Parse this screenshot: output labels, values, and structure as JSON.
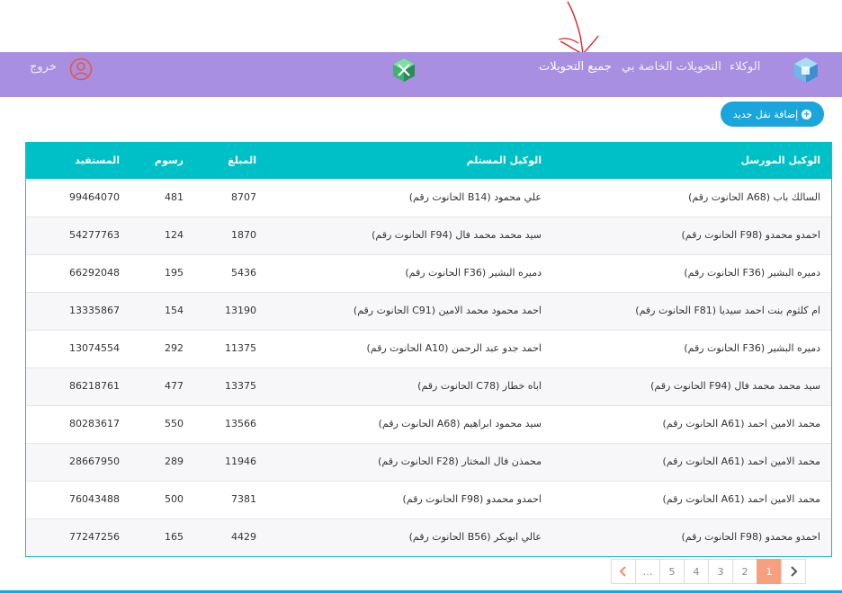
{
  "nav": {
    "agents": "الوكلاء",
    "my_transfers": "التحويلات الخاصة بي",
    "all_transfers": "جميع التحويلات",
    "logout": "خروج"
  },
  "actions": {
    "add_transfer": "إضافة نقل جديد"
  },
  "table": {
    "headers": {
      "sender": "الوكيل المورسل",
      "receiver": "الوكيل المستلم",
      "amount": "المبلغ",
      "fee": "رسوم",
      "beneficiary": "المستفيد"
    },
    "rows": [
      {
        "sender": "السالك باب (A68 الحانوت رقم)",
        "receiver": "علي محمود (B14 الحانوت رقم)",
        "amount": "8707",
        "fee": "481",
        "beneficiary": "99464070"
      },
      {
        "sender": "احمدو محمدو (F98 الحانوت رقم)",
        "receiver": "سيد محمد محمد فال (F94 الحانوت رقم)",
        "amount": "1870",
        "fee": "124",
        "beneficiary": "54277763"
      },
      {
        "sender": "دميره البشير (F36 الحانوت رقم)",
        "receiver": "دميره البشير (F36 الحانوت رقم)",
        "amount": "5436",
        "fee": "195",
        "beneficiary": "66292048"
      },
      {
        "sender": "ام كلثوم بنت احمد سيديا (F81 الحانوت رقم)",
        "receiver": "احمد محمود محمد الامين (C91 الحانوت رقم)",
        "amount": "13190",
        "fee": "154",
        "beneficiary": "13335867"
      },
      {
        "sender": "دميره البشير (F36 الحانوت رقم)",
        "receiver": "احمد جدو عبد الرحمن (A10 الحانوت رقم)",
        "amount": "11375",
        "fee": "292",
        "beneficiary": "13074554"
      },
      {
        "sender": "سيد محمد محمد فال (F94 الحانوت رقم)",
        "receiver": "اباه خطار (C78 الحانوت رقم)",
        "amount": "13375",
        "fee": "477",
        "beneficiary": "86218761"
      },
      {
        "sender": "محمد الامين احمد (A61 الحانوت رقم)",
        "receiver": "سيد محمود ابراهيم (A68 الحانوت رقم)",
        "amount": "13566",
        "fee": "550",
        "beneficiary": "80283617"
      },
      {
        "sender": "محمد الامين احمد (A61 الحانوت رقم)",
        "receiver": "محمذن فال المختار (F28 الحانوت رقم)",
        "amount": "11946",
        "fee": "289",
        "beneficiary": "28667950"
      },
      {
        "sender": "محمد الامين احمد (A61 الحانوت رقم)",
        "receiver": "احمدو محمدو (F98 الحانوت رقم)",
        "amount": "7381",
        "fee": "500",
        "beneficiary": "76043488"
      },
      {
        "sender": "احمدو محمدو (F98 الحانوت رقم)",
        "receiver": "عالي ابوبكر (B56 الحانوت رقم)",
        "amount": "4429",
        "fee": "165",
        "beneficiary": "77247256"
      }
    ]
  },
  "pagination": {
    "pages": [
      "…",
      "5",
      "4",
      "3",
      "2",
      "1"
    ],
    "current": "1"
  },
  "colors": {
    "navbar": "#a98fe2",
    "table_header": "#00c0c7",
    "button": "#1aa5dc",
    "page_active": "#f7a07f",
    "annotation": "#e02020"
  }
}
